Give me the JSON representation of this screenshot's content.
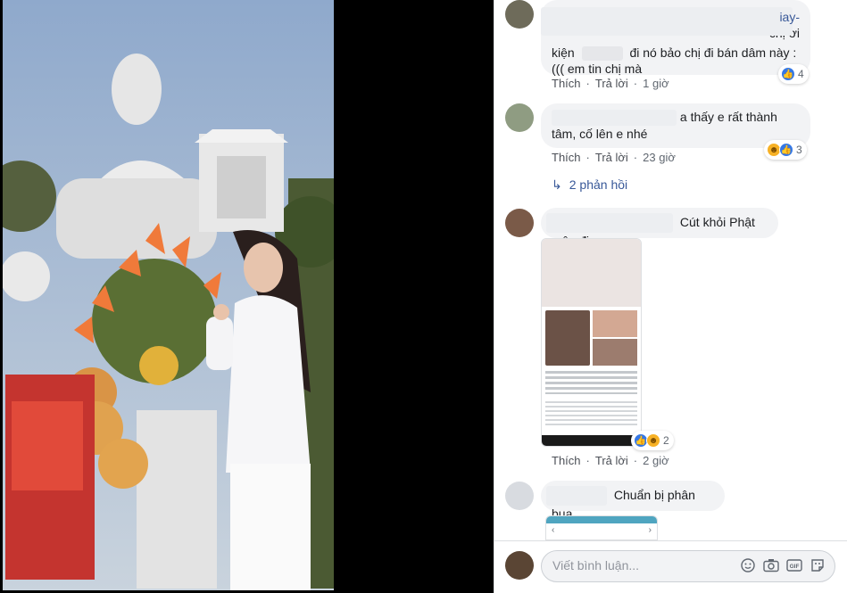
{
  "comments": [
    {
      "text_lines": [
        "iay-",
        "chị ơi",
        "kiện",
        "đi nó bảo chị đi bán dâm này :",
        "((( em tin chị mà"
      ],
      "actions": {
        "like": "Thích",
        "reply": "Trả lời",
        "time": "1 giờ"
      },
      "reactions": {
        "icons": [
          "like-icon"
        ],
        "count": "4"
      }
    },
    {
      "text_lines": [
        "a thấy e rất thành",
        "tâm, cố lên e nhé"
      ],
      "actions": {
        "like": "Thích",
        "reply": "Trả lời",
        "time": "23 giờ"
      },
      "reactions": {
        "icons": [
          "haha-icon",
          "like-icon"
        ],
        "count": "3"
      },
      "replies": "2 phản hồi"
    },
    {
      "text_lines": [
        "Cút khỏi Phật môn đi"
      ],
      "actions": {
        "like": "Thích",
        "reply": "Trả lời",
        "time": "2 giờ"
      },
      "reactions": {
        "icons": [
          "like-icon",
          "haha-icon"
        ],
        "count": "2"
      }
    },
    {
      "text_lines": [
        "Chuẩn bị phân bua"
      ]
    }
  ],
  "composer": {
    "placeholder": "Viết bình luận..."
  },
  "colors": {
    "link": "#385898",
    "like_blue": "#3578e5",
    "bubble": "#f2f3f5"
  }
}
